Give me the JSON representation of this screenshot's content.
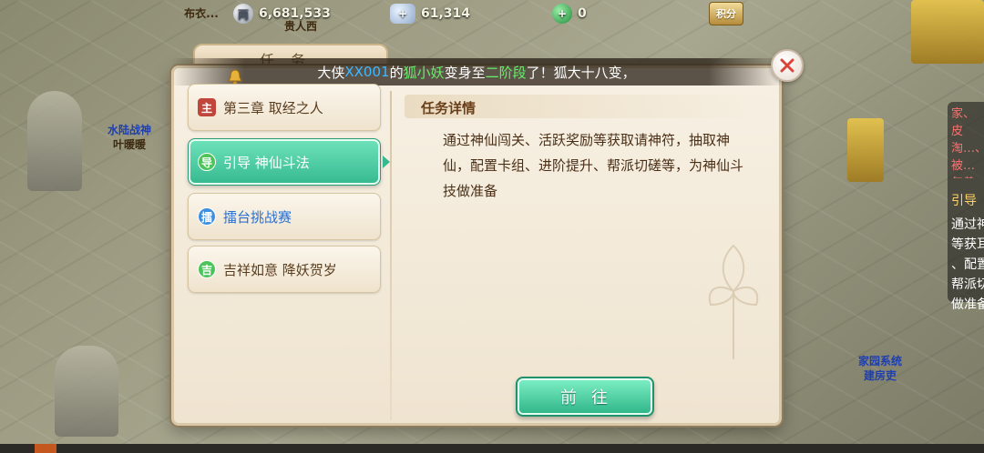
{
  "background": {
    "npc_top_name": "布衣...",
    "npc_top_sub": "贵人西",
    "npc_left_title": "水陆战神",
    "npc_left_name": "叶暖暖",
    "npc_right_title": "家园系统",
    "npc_right_name": "建房吏"
  },
  "resources": {
    "silver": "6,681,533",
    "ingot": "61,314",
    "jade": "0",
    "score_button": "积分"
  },
  "dialog": {
    "tab_title": "任务",
    "notice": {
      "p1": "大侠",
      "player": "XX001",
      "p2": "的",
      "pet": "狐小妖",
      "p3": "变身至",
      "stage": "二阶段",
      "p4": "了！狐大十八变，"
    },
    "quests": [
      {
        "icon_text": "主",
        "label": "第三章  取经之人"
      },
      {
        "icon_text": "导",
        "label": "引导  神仙斗法"
      },
      {
        "icon_text": "擂",
        "label": "擂台挑战赛"
      },
      {
        "icon_text": "吉",
        "label": "吉祥如意  降妖贺岁"
      }
    ],
    "detail_title": "任务详情",
    "detail_text": "通过神仙闯关、活跃奖励等获取请神符，抽取神仙，配置卡组、进阶提升、帮派切磋等，为神仙斗技做准备",
    "go_button": "前往"
  },
  "right_panel": {
    "red_text": "家、皮淘…、被…年兽",
    "line1": "引导",
    "line2": "通过神",
    "line3": "等获耳",
    "line4": "、配置",
    "line5": "帮派切",
    "line6": "做准备"
  },
  "colors": {
    "accent_green": "#35b98f",
    "player_name": "#3fb7ff",
    "highlight_green": "#66ef6a"
  }
}
